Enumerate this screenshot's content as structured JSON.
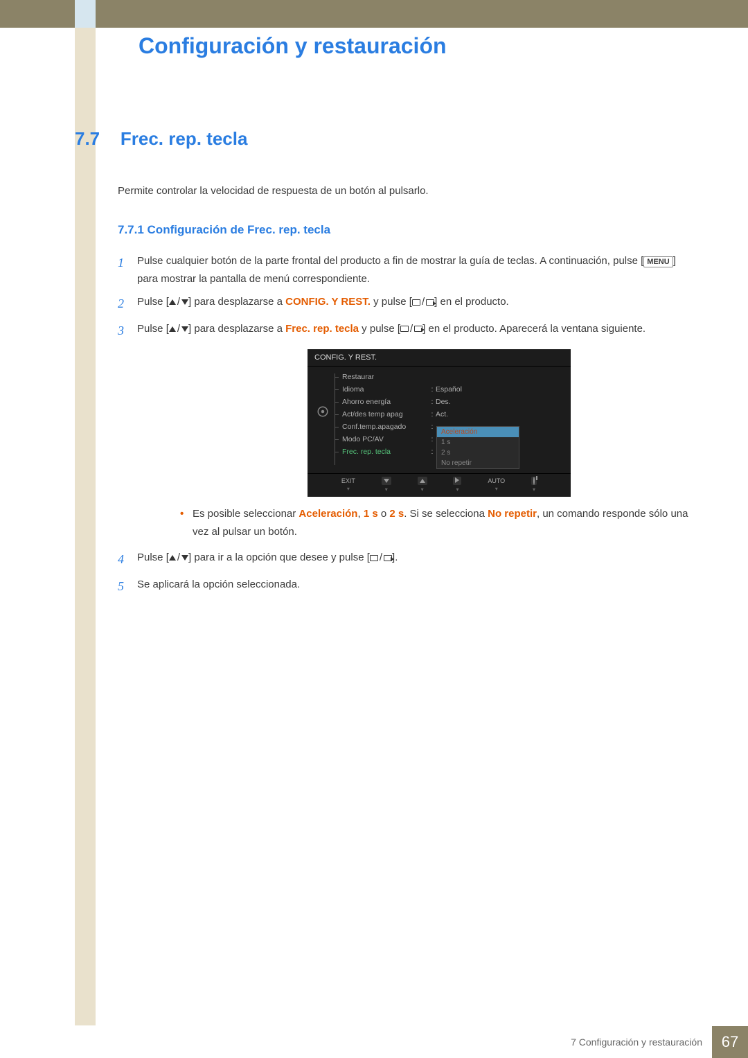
{
  "chapter_title": "Configuración y restauración",
  "section": {
    "num": "7.7",
    "title": "Frec. rep. tecla"
  },
  "intro": "Permite controlar la velocidad de respuesta de un botón al pulsarlo.",
  "subsection": "7.7.1   Configuración de Frec. rep. tecla",
  "steps": {
    "s1": {
      "num": "1",
      "a": "Pulse cualquier botón de la parte frontal del producto a fin de mostrar la guía de teclas. A continuación, pulse [",
      "menu": "MENU",
      "b": "] para mostrar la pantalla de menú correspondiente."
    },
    "s2": {
      "num": "2",
      "a": "Pulse [",
      "b": "] para desplazarse a ",
      "target": "CONFIG. Y REST.",
      "c": " y pulse [",
      "d": "] en el producto."
    },
    "s3": {
      "num": "3",
      "a": "Pulse [",
      "b": "] para desplazarse a ",
      "target": "Frec. rep. tecla",
      "c": " y pulse [",
      "d": "] en el producto. Aparecerá la ventana siguiente."
    },
    "s4": {
      "num": "4",
      "a": "Pulse [",
      "b": "] para ir a la opción que desee y pulse [",
      "c": "]."
    },
    "s5": {
      "num": "5",
      "text": "Se aplicará la opción seleccionada."
    }
  },
  "bullet": {
    "a": "Es posible seleccionar ",
    "opt1": "Aceleración",
    "sep1": ", ",
    "opt2": "1 s",
    "sep2": " o ",
    "opt3": "2 s",
    "b": ". Si se selecciona ",
    "opt4": "No repetir",
    "c": ", un comando responde sólo una vez al pulsar un botón."
  },
  "osd": {
    "title": "CONFIG. Y REST.",
    "rows": {
      "r1": {
        "label": "Restaurar",
        "val": ""
      },
      "r2": {
        "label": "Idioma",
        "val": "Español"
      },
      "r3": {
        "label": "Ahorro energía",
        "val": "Des."
      },
      "r4": {
        "label": "Act/des temp apag",
        "val": "Act."
      },
      "r5": {
        "label": "Conf.temp.apagado",
        "val": ""
      },
      "r6": {
        "label": "Modo PC/AV",
        "val": ""
      },
      "r7": {
        "label": "Frec. rep. tecla",
        "val": ""
      }
    },
    "submenu": {
      "o1": "Aceleración",
      "o2": "1 s",
      "o3": "2 s",
      "o4": "No repetir"
    },
    "footer": {
      "exit": "EXIT",
      "auto": "AUTO"
    }
  },
  "footer": {
    "text": "7 Configuración y restauración",
    "page": "67"
  }
}
